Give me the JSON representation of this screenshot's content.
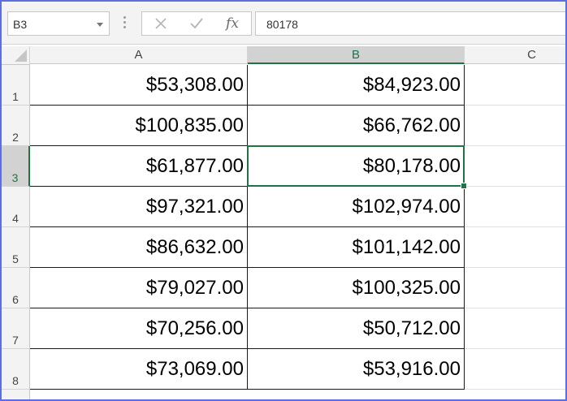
{
  "formula_bar": {
    "name_box": "B3",
    "formula_value": "80178",
    "cancel_icon": "x-icon",
    "enter_icon": "check-icon",
    "fx_label": "fx"
  },
  "columns": [
    "A",
    "B",
    "C"
  ],
  "selected_column": "B",
  "selected_row": "3",
  "rows": [
    {
      "num": "1",
      "a": "$53,308.00",
      "b": "$84,923.00"
    },
    {
      "num": "2",
      "a": "$100,835.00",
      "b": "$66,762.00"
    },
    {
      "num": "3",
      "a": "$61,877.00",
      "b": "$80,178.00"
    },
    {
      "num": "4",
      "a": "$97,321.00",
      "b": "$102,974.00"
    },
    {
      "num": "5",
      "a": "$86,632.00",
      "b": "$101,142.00"
    },
    {
      "num": "6",
      "a": "$79,027.00",
      "b": "$100,325.00"
    },
    {
      "num": "7",
      "a": "$70,256.00",
      "b": "$50,712.00"
    },
    {
      "num": "8",
      "a": "$73,069.00",
      "b": "$53,916.00"
    }
  ],
  "colors": {
    "accent": "#217346",
    "frame": "#5b6fe0"
  }
}
